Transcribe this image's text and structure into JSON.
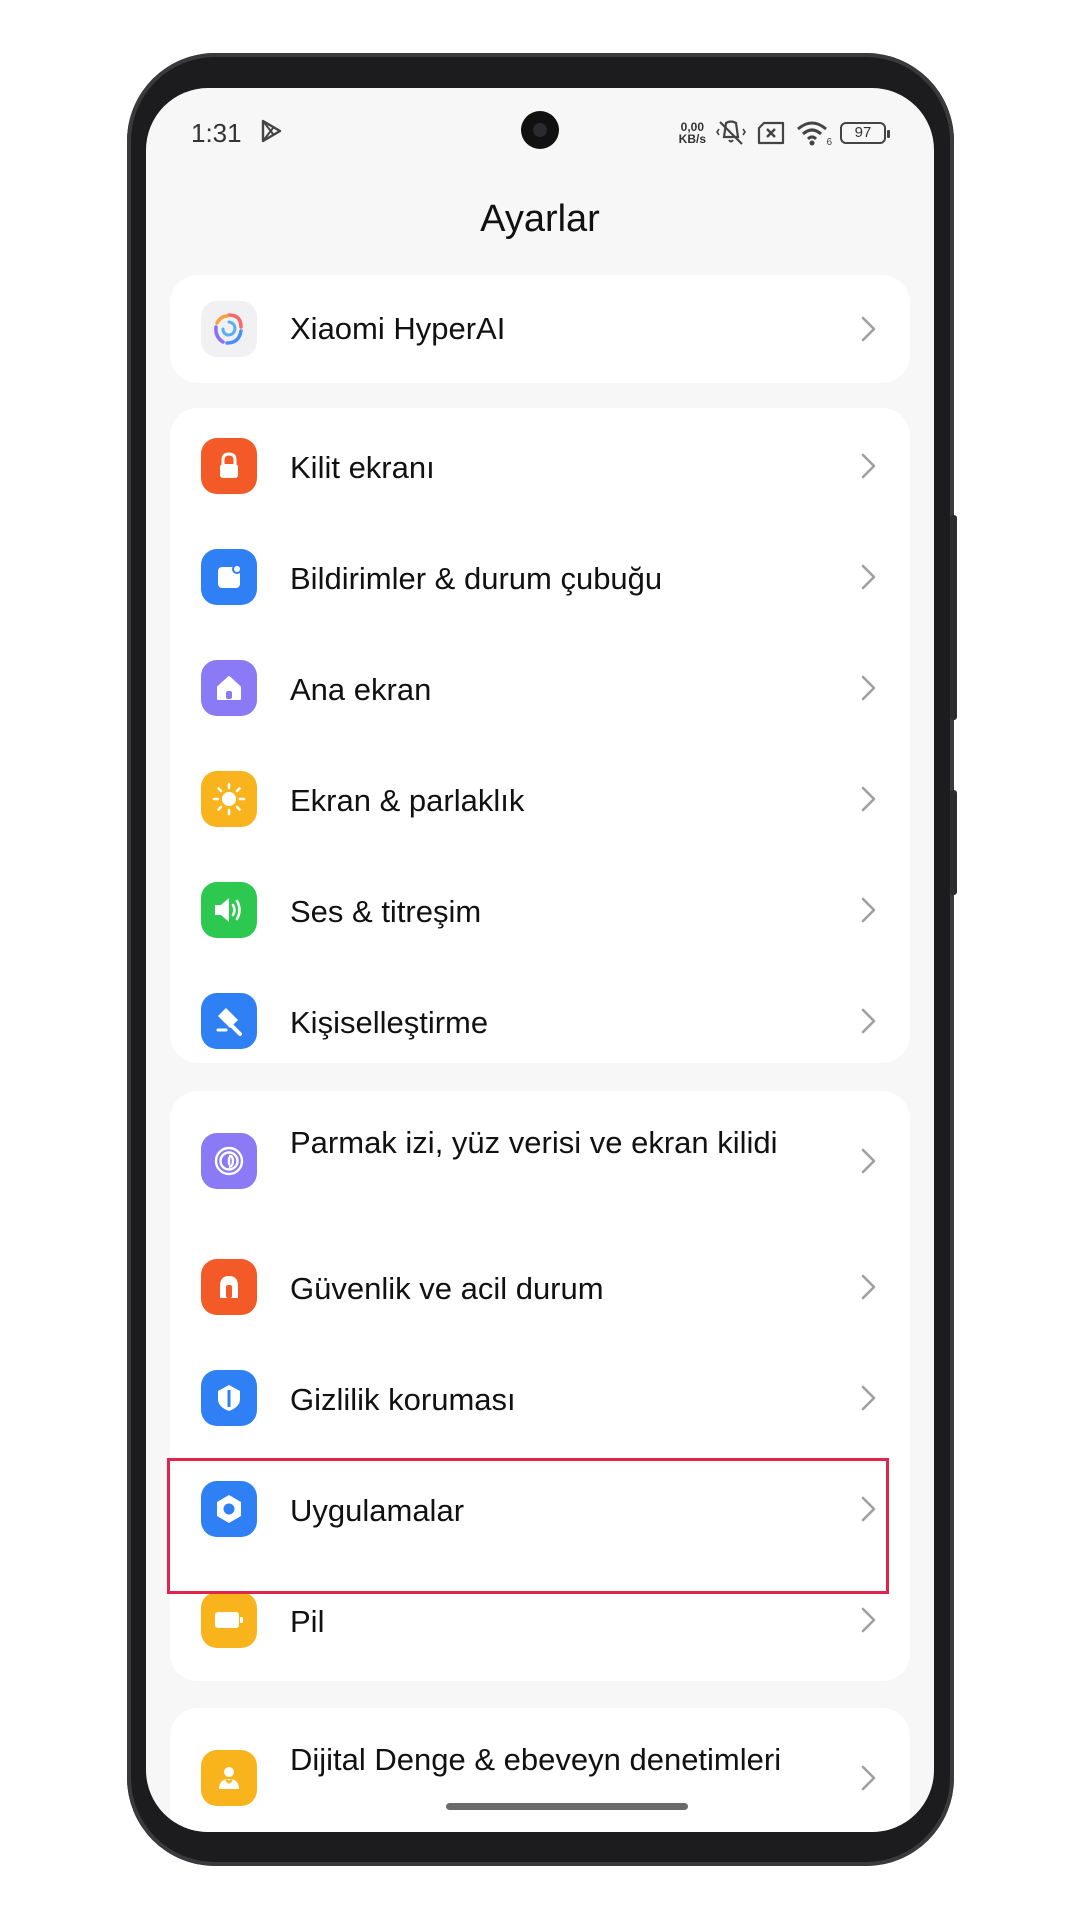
{
  "status_bar": {
    "time": "1:31",
    "net_speed_value": "0,00",
    "net_speed_unit": "KB/s",
    "wifi_badge": "6",
    "battery": "97"
  },
  "header": {
    "title": "Ayarlar"
  },
  "cards": {
    "card1": [
      {
        "label": "Xiaomi HyperAI",
        "icon": "hyperai-swirl-icon"
      }
    ],
    "card2": [
      {
        "label": "Kilit ekranı",
        "icon": "lock-icon",
        "color": "#f45a28"
      },
      {
        "label": "Bildirimler & durum çubuğu",
        "icon": "notification-icon",
        "color": "#2f7ff5"
      },
      {
        "label": "Ana ekran",
        "icon": "home-icon",
        "color": "#8a7af5"
      },
      {
        "label": "Ekran & parlaklık",
        "icon": "sun-icon",
        "color": "#f9b31d"
      },
      {
        "label": "Ses & titreşim",
        "icon": "speaker-icon",
        "color": "#2cc84f"
      },
      {
        "label": "Kişiselleştirme",
        "icon": "brush-icon",
        "color": "#2f7ff5"
      }
    ],
    "card3": [
      {
        "label": "Parmak izi, yüz verisi ve ekran kilidi",
        "icon": "fingerprint-icon",
        "color": "#8a7af5"
      },
      {
        "label": "Güvenlik ve acil durum",
        "icon": "emergency-icon",
        "color": "#f45a28"
      },
      {
        "label": "Gizlilik koruması",
        "icon": "privacy-icon",
        "color": "#2f7ff5"
      },
      {
        "label": "Uygulamalar",
        "icon": "apps-hexagon-icon",
        "color": "#2f7ff5"
      },
      {
        "label": "Pil",
        "icon": "battery-icon",
        "color": "#f9b31d"
      }
    ],
    "card4": [
      {
        "label": "Dijital Denge & ebeveyn denetimleri",
        "icon": "wellbeing-icon",
        "color": "#f9b31d"
      }
    ]
  },
  "highlighted_item": "Uygulamalar"
}
